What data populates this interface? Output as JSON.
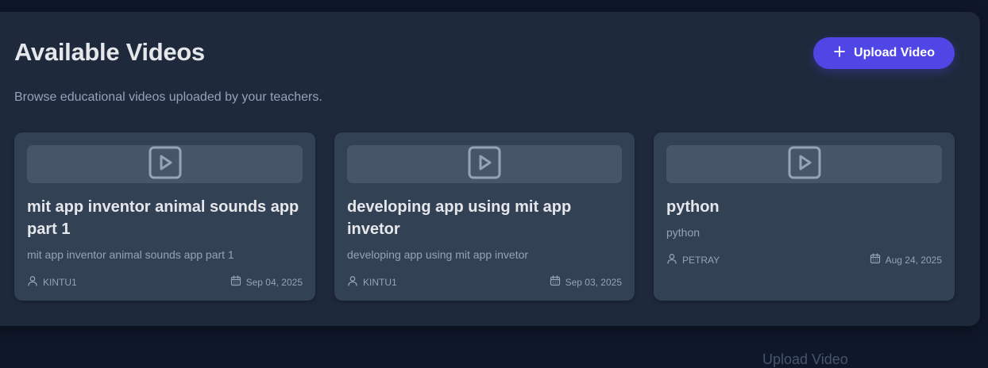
{
  "header": {
    "title": "Available Videos",
    "subtitle": "Browse educational videos uploaded by your teachers.",
    "upload_label": "Upload Video"
  },
  "videos": [
    {
      "title": "mit app inventor animal sounds app part 1",
      "description": "mit app inventor animal sounds app part 1",
      "author": "KINTU1",
      "date": "Sep 04, 2025"
    },
    {
      "title": "developing app using mit app invetor",
      "description": "developing app using mit app invetor",
      "author": "KINTU1",
      "date": "Sep 03, 2025"
    },
    {
      "title": "python",
      "description": "python",
      "author": "PETRAY",
      "date": "Aug 24, 2025"
    }
  ],
  "footer": {
    "partial_text": "Upload Video"
  },
  "colors": {
    "accent": "#4f46e5",
    "panel": "#1e293b",
    "card": "#334155",
    "background": "#0f172a"
  },
  "icons": [
    "plus-icon",
    "play-icon",
    "user-icon",
    "calendar-icon"
  ]
}
